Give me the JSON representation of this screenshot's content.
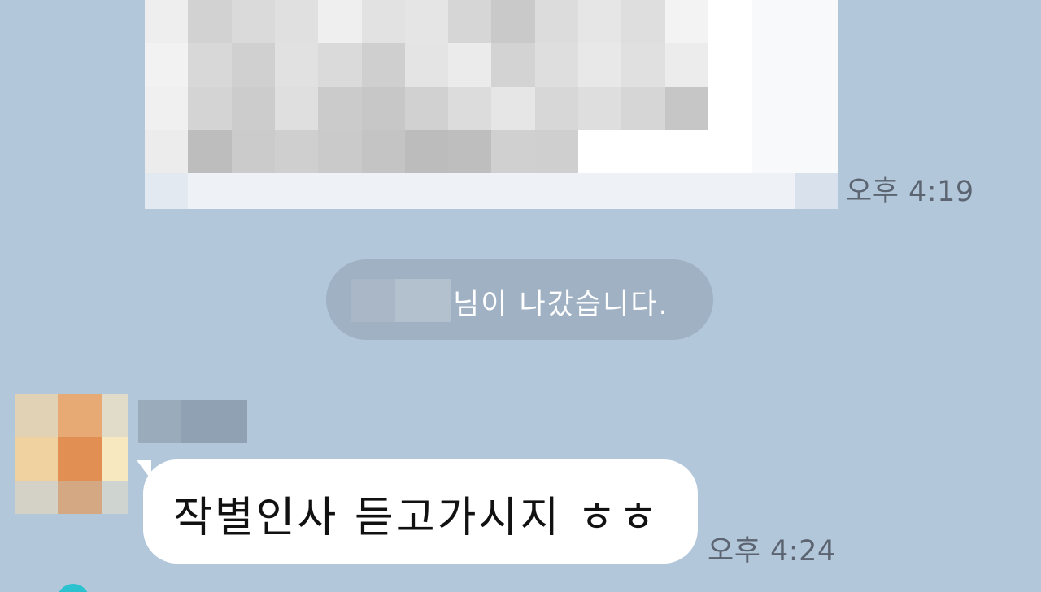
{
  "chat": {
    "background_color": "#b2c7da",
    "messages": [
      {
        "type": "image",
        "content": "pixelated-image",
        "time": "오후 4:19"
      }
    ],
    "system_notice": {
      "text": "님이 나갔습니다."
    },
    "incoming": {
      "avatar": "pixelated-avatar",
      "text": "작별인사 듣고가시지 ㅎㅎ",
      "time": "오후 4:24"
    }
  },
  "colors": {
    "bubble": "#ffffff",
    "notice_pill": "#9fb1c3",
    "timestamp": "#5b6470"
  }
}
